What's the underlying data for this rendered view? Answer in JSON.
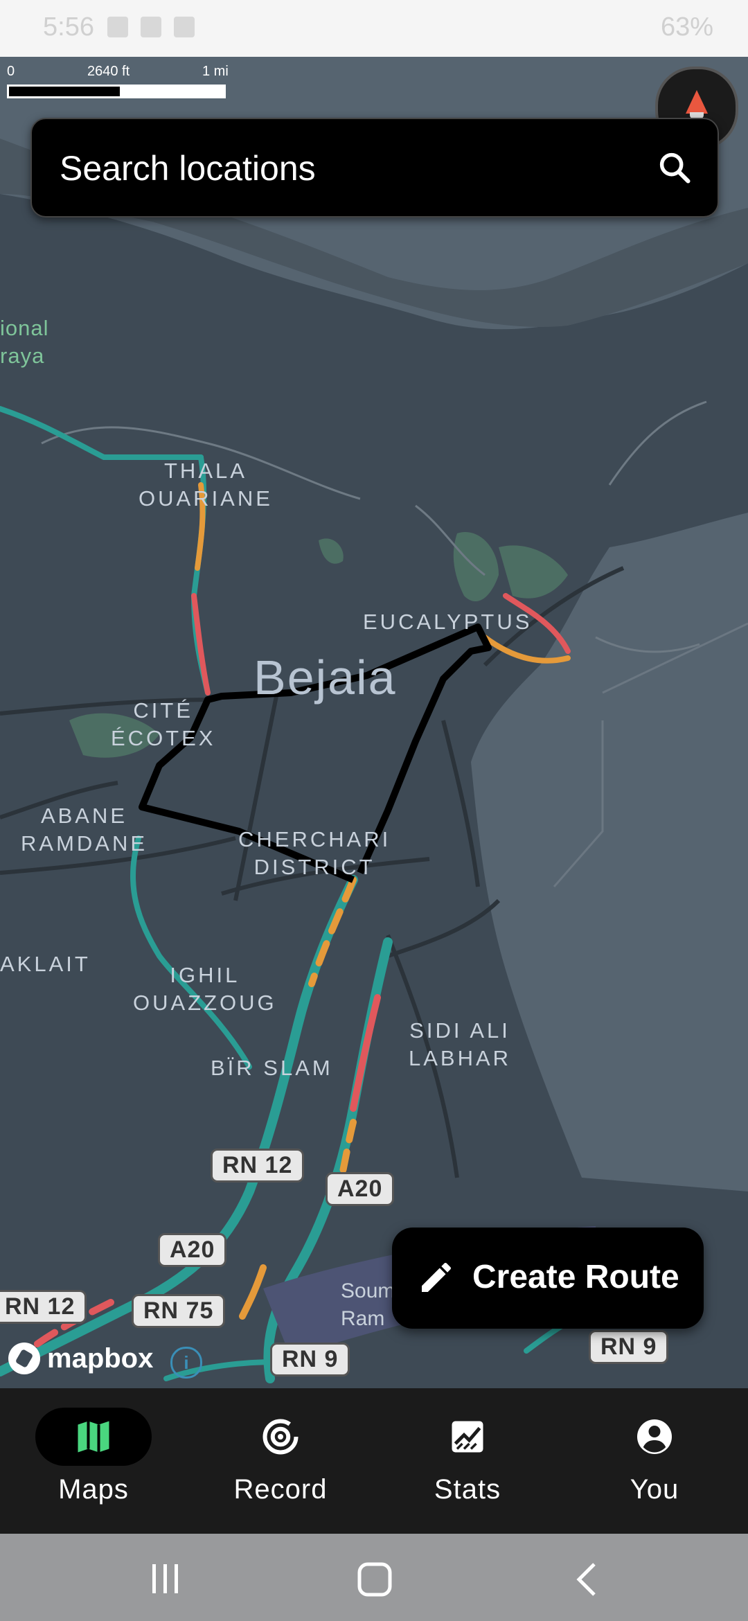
{
  "status_bar": {
    "time": "5:56",
    "battery": "63%"
  },
  "map": {
    "scale": {
      "start": "0",
      "mid": "2640 ft",
      "end": "1 mi"
    },
    "labels": {
      "thala": "THALA\nOUARIANE",
      "eucalyptus": "EUCALYPTUS",
      "bejaia": "Bejaia",
      "cite": "CITÉ\nÉCOTEX",
      "abane": "ABANE\nRAMDANE",
      "cherchari": "CHERCHARI\nDISTRICT",
      "aklait": "AKLAIT",
      "ighil": "IGHIL\nOUAZZOUG",
      "bir_slam": "BÏR SLAM",
      "sidi_ali": "SIDI ALI\nLABHAR",
      "park": "ional\nraya",
      "soum": "Soum\nRam"
    },
    "road_shields": [
      "RN 12",
      "A20",
      "A20",
      "RN 12",
      "RN 75",
      "RN 9",
      "RN 9"
    ],
    "colors": {
      "land": "#3e4a55",
      "water": "#566470",
      "route": "#000000",
      "traffic_green": "#2a9d94",
      "traffic_orange": "#e59a3a",
      "traffic_red": "#e0585c"
    }
  },
  "search": {
    "placeholder": "Search locations"
  },
  "create_route": {
    "label": "Create Route"
  },
  "attribution": {
    "brand": "mapbox",
    "info": "i"
  },
  "nav": [
    {
      "label": "Maps",
      "icon": "map-icon",
      "active": true
    },
    {
      "label": "Record",
      "icon": "record-icon",
      "active": false
    },
    {
      "label": "Stats",
      "icon": "stats-icon",
      "active": false
    },
    {
      "label": "You",
      "icon": "account-icon",
      "active": false
    }
  ],
  "system_nav": {
    "recents": "recents-icon",
    "home": "home-icon",
    "back": "back-icon"
  }
}
